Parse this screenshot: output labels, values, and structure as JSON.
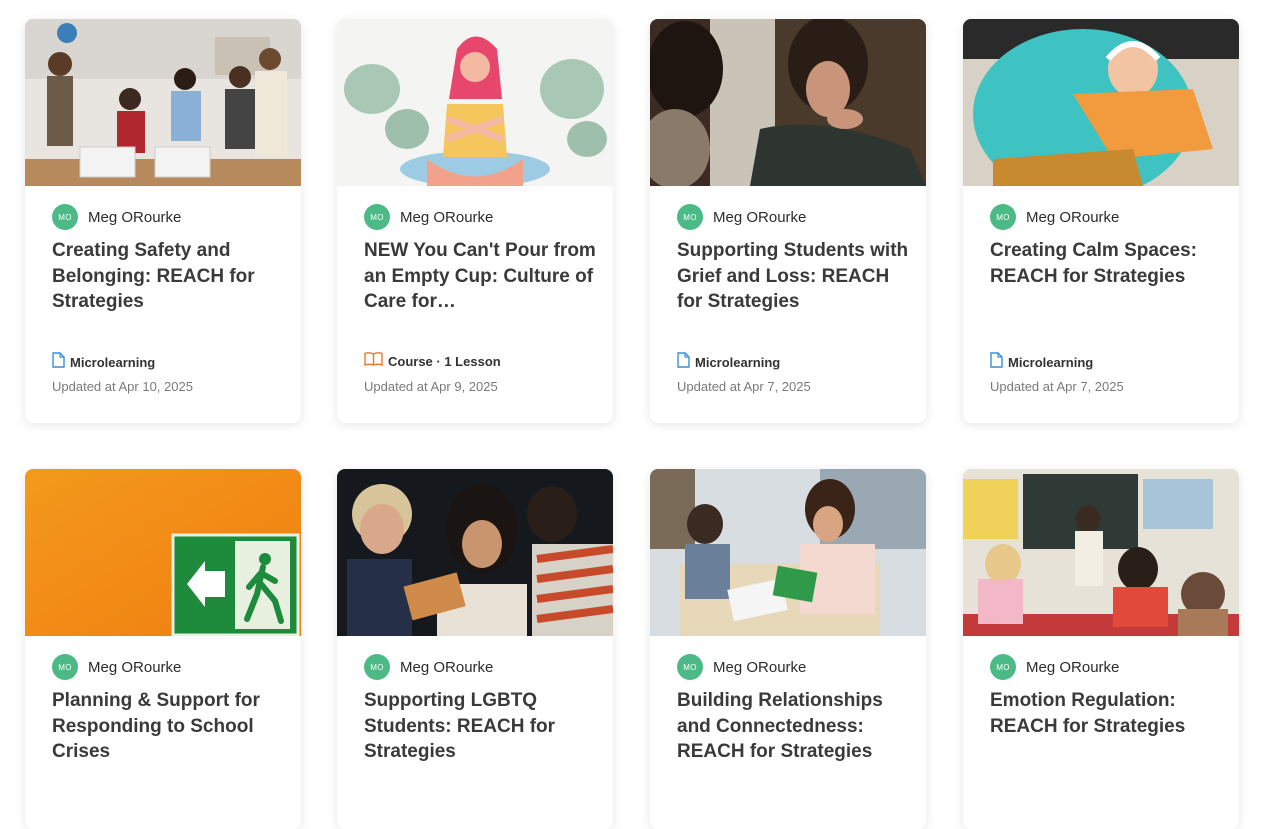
{
  "cards": [
    {
      "author_initials": "MO",
      "author": "Meg ORourke",
      "title": "Creating Safety and Belonging: REACH for Strategies",
      "type_icon": "document-icon",
      "type_label": "Microlearning",
      "updated": "Updated at Apr 10, 2025"
    },
    {
      "author_initials": "MO",
      "author": "Meg ORourke",
      "title": "NEW You Can't Pour from an Empty Cup: Culture of Care for…",
      "type_icon": "book-icon",
      "type_label": "Course · 1 Lesson",
      "updated": "Updated at Apr 9, 2025"
    },
    {
      "author_initials": "MO",
      "author": "Meg ORourke",
      "title": "Supporting Students with Grief and Loss: REACH for Strategies",
      "type_icon": "document-icon",
      "type_label": "Microlearning",
      "updated": "Updated at Apr 7, 2025"
    },
    {
      "author_initials": "MO",
      "author": "Meg ORourke",
      "title": "Creating Calm Spaces: REACH for Strategies",
      "type_icon": "document-icon",
      "type_label": "Microlearning",
      "updated": "Updated at Apr 7, 2025"
    },
    {
      "author_initials": "MO",
      "author": "Meg ORourke",
      "title": "Planning & Support for Responding to School Crises"
    },
    {
      "author_initials": "MO",
      "author": "Meg ORourke",
      "title": "Supporting LGBTQ Students: REACH for Strategies"
    },
    {
      "author_initials": "MO",
      "author": "Meg ORourke",
      "title": "Building Relationships and Connectedness: REACH for Strategies"
    },
    {
      "author_initials": "MO",
      "author": "Meg ORourke",
      "title": "Emotion Regulation: REACH for Strategies"
    }
  ],
  "colors": {
    "avatar": "#4cba86",
    "doc_icon": "#3b8fd9",
    "book_icon": "#e8772e"
  }
}
